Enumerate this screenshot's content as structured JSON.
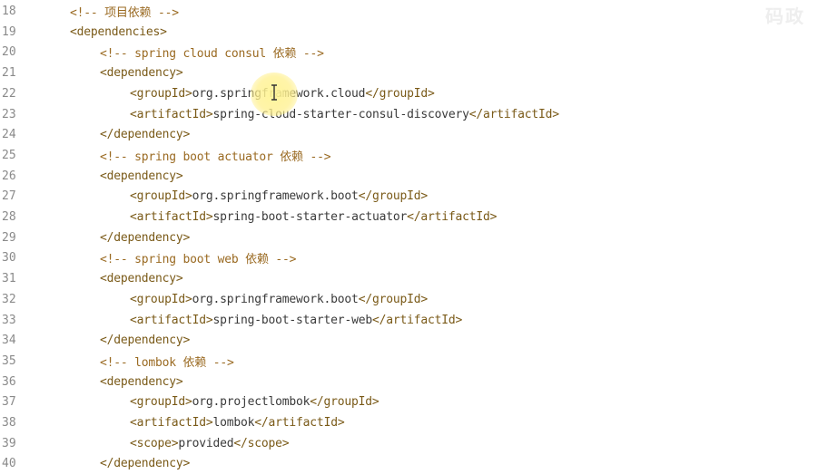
{
  "watermark": "码政",
  "lines": [
    {
      "num": "18",
      "comment": "<!-- 项目依赖 -->"
    },
    {
      "num": "19",
      "open": "<dependencies>"
    },
    {
      "num": "20",
      "comment": "<!-- spring cloud consul 依赖 -->"
    },
    {
      "num": "21",
      "open": "<dependency>"
    },
    {
      "num": "22",
      "open": "<groupId>",
      "text": "org.springframework.cloud",
      "close": "</groupId>"
    },
    {
      "num": "23",
      "open": "<artifactId>",
      "text": "spring-cloud-starter-consul-discovery",
      "close": "</artifactId>"
    },
    {
      "num": "24",
      "open": "</dependency>"
    },
    {
      "num": "25",
      "comment": "<!-- spring boot actuator 依赖 -->"
    },
    {
      "num": "26",
      "open": "<dependency>"
    },
    {
      "num": "27",
      "open": "<groupId>",
      "text": "org.springframework.boot",
      "close": "</groupId>"
    },
    {
      "num": "28",
      "open": "<artifactId>",
      "text": "spring-boot-starter-actuator",
      "close": "</artifactId>"
    },
    {
      "num": "29",
      "open": "</dependency>"
    },
    {
      "num": "30",
      "comment": "<!-- spring boot web 依赖 -->"
    },
    {
      "num": "31",
      "open": "<dependency>"
    },
    {
      "num": "32",
      "open": "<groupId>",
      "text": "org.springframework.boot",
      "close": "</groupId>"
    },
    {
      "num": "33",
      "open": "<artifactId>",
      "text": "spring-boot-starter-web",
      "close": "</artifactId>"
    },
    {
      "num": "34",
      "open": "</dependency>"
    },
    {
      "num": "35",
      "comment": "<!-- lombok 依赖 -->"
    },
    {
      "num": "36",
      "open": "<dependency>"
    },
    {
      "num": "37",
      "open": "<groupId>",
      "text": "org.projectlombok",
      "close": "</groupId>"
    },
    {
      "num": "38",
      "open": "<artifactId>",
      "text": "lombok",
      "close": "</artifactId>"
    },
    {
      "num": "39",
      "open": "<scope>",
      "text": "provided",
      "close": "</scope>"
    },
    {
      "num": "40",
      "open": "</dependency>"
    }
  ]
}
